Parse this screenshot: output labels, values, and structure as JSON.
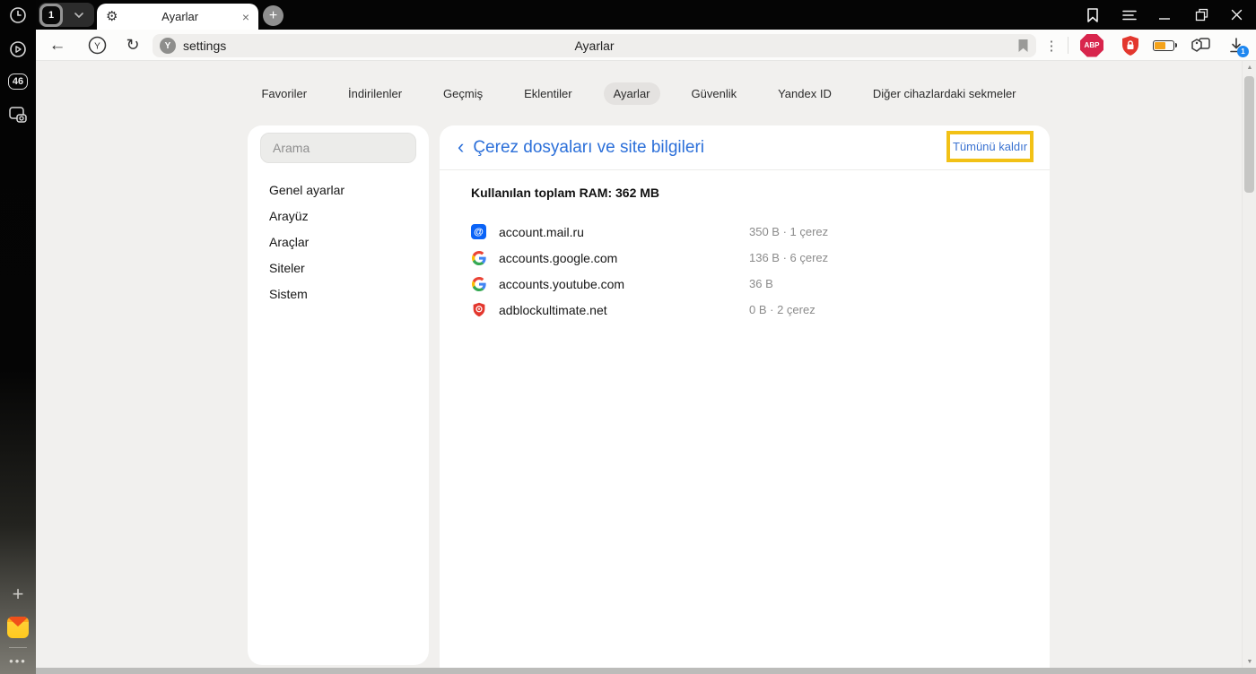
{
  "window": {
    "tab_count": "1",
    "tab_title": "Ayarlar",
    "new_tab_glyph": "+",
    "close_glyph": "×",
    "gear_glyph": "⚙",
    "rail_badge": "46",
    "rail_dots": "•••",
    "rail_plus": "+"
  },
  "toolbar": {
    "back_glyph": "←",
    "refresh_glyph": "↻",
    "yandex_letter": "Y",
    "favicon_letter": "Y",
    "url": "settings",
    "page_title": "Ayarlar",
    "kebab_glyph": "⋮",
    "abp_label": "ABP",
    "download_badge": "1"
  },
  "nav": {
    "items": [
      "Favoriler",
      "İndirilenler",
      "Geçmiş",
      "Eklentiler",
      "Ayarlar",
      "Güvenlik",
      "Yandex ID",
      "Diğer cihazlardaki sekmeler"
    ],
    "active": "Ayarlar"
  },
  "sidebar": {
    "search_placeholder": "Arama",
    "items": [
      "Genel ayarlar",
      "Arayüz",
      "Araçlar",
      "Siteler",
      "Sistem"
    ]
  },
  "content": {
    "back_glyph": "‹",
    "title": "Çerez dosyaları ve site bilgileri",
    "remove_all": "Tümünü kaldır",
    "ram_total": "Kullanılan toplam RAM: 362 MB",
    "sites": [
      {
        "domain": "account.mail.ru",
        "size": "350 B · 1 çerez",
        "icon": "mailru-at"
      },
      {
        "domain": "accounts.google.com",
        "size": "136 B · 6 çerez",
        "icon": "google-g"
      },
      {
        "domain": "accounts.youtube.com",
        "size": "36 B",
        "icon": "google-g"
      },
      {
        "domain": "adblockultimate.net",
        "size": "0 B · 2 çerez",
        "icon": "red-shield"
      }
    ],
    "mailru_letter": "@"
  },
  "scrollbar": {
    "up_glyph": "▲",
    "down_glyph": "▼"
  },
  "colors": {
    "accent_blue": "#2b6fd9",
    "annotation_yellow": "#f2c116",
    "abp_red": "#d8254c",
    "shield_red": "#e3372e",
    "battery_orange": "#f5a31a",
    "mailru_blue": "#0a63f7",
    "download_badge_blue": "#1e87f0"
  }
}
